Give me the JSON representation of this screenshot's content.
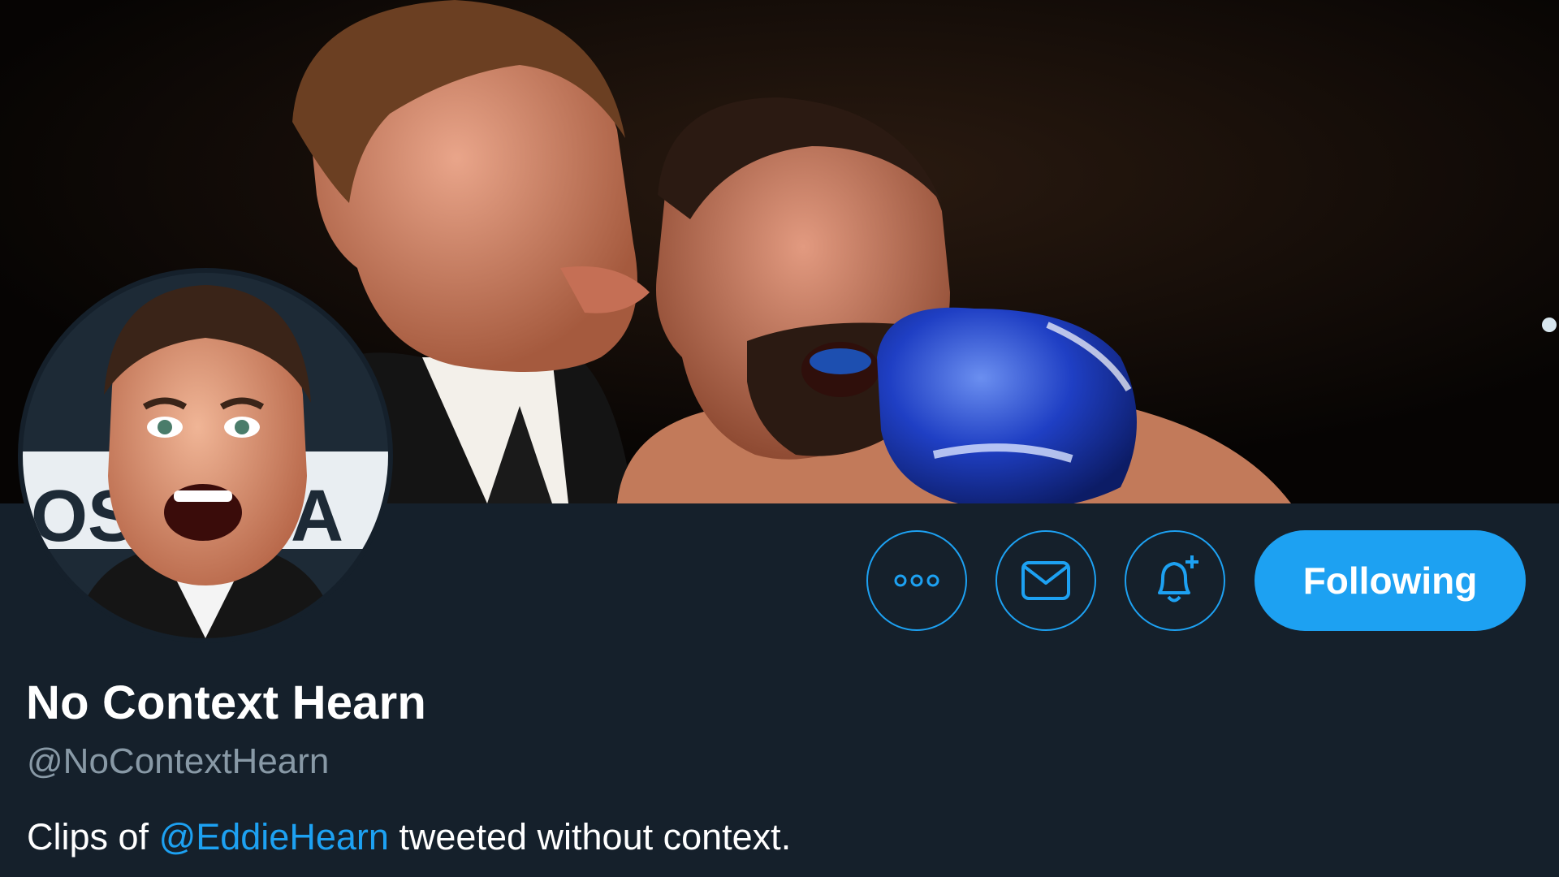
{
  "profile": {
    "display_name": "No Context Hearn",
    "handle": "@NoContextHearn",
    "bio": {
      "before": "Clips of ",
      "mention": "@EddieHearn",
      "after": " tweeted without context."
    }
  },
  "actions": {
    "more_icon": "more-dots-icon",
    "message_icon": "envelope-icon",
    "notify_icon": "bell-plus-icon",
    "follow_label": "Following"
  },
  "colors": {
    "background": "#15202b",
    "accent": "#1da1f2",
    "secondary_text": "#8899a6",
    "primary_text": "#ffffff"
  }
}
